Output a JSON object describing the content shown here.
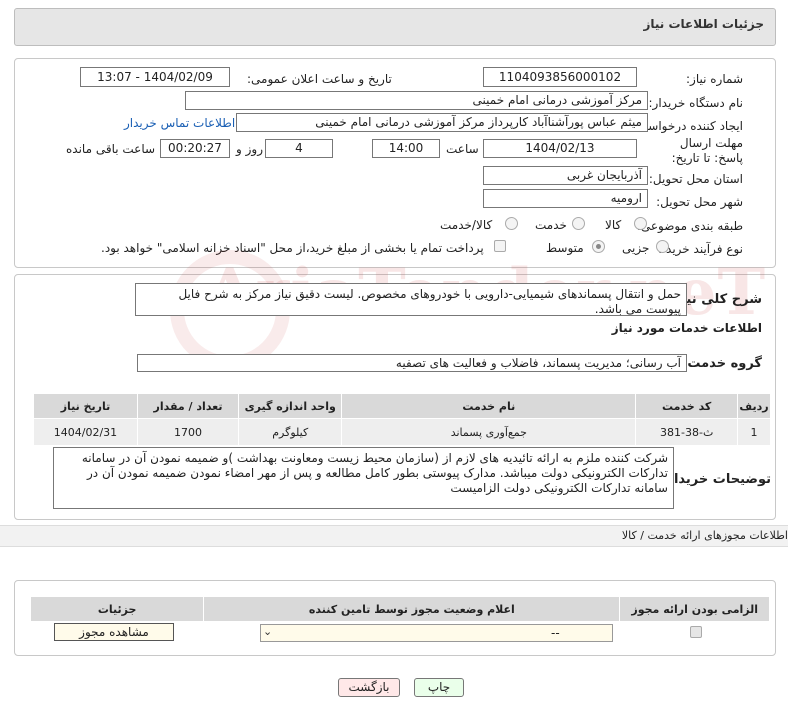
{
  "header": {
    "title": "جزئیات اطلاعات نیاز"
  },
  "watermark": "AriaTender.neT",
  "form": {
    "need_number_label": "شماره نیاز:",
    "need_number": "1104093856000102",
    "announce_label": "تاریخ و ساعت اعلان عمومی:",
    "announce_value": "1404/02/09 - 13:07",
    "buyer_org_label": "نام دستگاه خریدار:",
    "buyer_org": "مرکز آموزشی درمانی امام خمینی",
    "requester_label": "ایجاد کننده درخواست:",
    "requester": "میثم عباس پورآشناآباد کارپرداز مرکز آموزشی درمانی امام خمینی",
    "contact_link": "اطلاعات تماس خریدار",
    "deadline_label": "مهلت ارسال پاسخ: تا تاریخ:",
    "deadline_date": "1404/02/13",
    "time_label": "ساعت",
    "deadline_time": "14:00",
    "days_value": "4",
    "days_label": "روز و",
    "remaining_time": "00:20:27",
    "remaining_label": "ساعت باقی مانده",
    "province_label": "استان محل تحویل:",
    "province": "آذربایجان غربی",
    "city_label": "شهر محل تحویل:",
    "city": "ارومیه",
    "category_label": "طبقه بندی موضوعی:",
    "category_options": [
      "کالا",
      "خدمت",
      "کالا/خدمت"
    ],
    "process_label": "نوع فرآیند خرید :",
    "process_options": [
      "جزیی",
      "متوسط"
    ],
    "payment_note": "پرداخت تمام یا بخشی از مبلغ خرید،از محل \"اسناد خزانه اسلامی\" خواهد بود."
  },
  "summary": {
    "label": "شرح کلی نیاز:",
    "text": "حمل و انتقال پسماندهای شیمیایی-دارویی با خودروهای مخصوص. لیست دقیق نیاز مرکز به شرح فایل پیوست می باشد.",
    "services_title": "اطلاعات خدمات مورد نیاز",
    "service_group_label": "گروه خدمت:",
    "service_group": "آب رسانی؛ مدیریت پسماند، فاضلاب و فعالیت های تصفیه"
  },
  "items_table": {
    "headers": [
      "ردیف",
      "کد خدمت",
      "نام خدمت",
      "واحد اندازه گیری",
      "تعداد / مقدار",
      "تاریخ نیاز"
    ],
    "rows": [
      [
        "1",
        "ث-38-381",
        "جمع‌آوری پسماند",
        "کیلوگرم",
        "1700",
        "1404/02/31"
      ]
    ]
  },
  "buyer_notes": {
    "label": "توضیحات خریدار:",
    "text": "شرکت کننده ملزم به ارائه تائیدیه های لازم از (سازمان محیط زیست ومعاونت بهداشت )و ضمیمه نمودن آن در سامانه تدارکات الکترونیکی دولت میباشد. مدارک پیوستی بطور کامل مطالعه و پس از مهر امضاء نمودن ضمیمه نمودن آن در سامانه تدارکات الکترونیکی دولت الزامیست"
  },
  "permits": {
    "section_title": "اطلاعات مجوزهای ارائه خدمت / کالا",
    "headers": [
      "الزامی بودن ارائه مجوز",
      "اعلام وضعیت مجوز توسط تامین کننده",
      "جزئیات"
    ],
    "select_value": "--",
    "view_button": "مشاهده مجوز"
  },
  "footer": {
    "print_button": "چاپ",
    "back_button": "بازگشت"
  }
}
